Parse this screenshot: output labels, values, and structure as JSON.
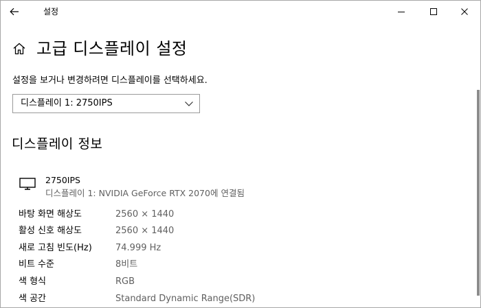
{
  "window": {
    "title": "설정",
    "back_icon": "arrow-left",
    "controls": [
      "minimize",
      "maximize",
      "close"
    ]
  },
  "page": {
    "title": "고급 디스플레이 설정",
    "home_icon": "home",
    "instruction": "설정을 보거나 변경하려면 디스플레이를 선택하세요."
  },
  "display_select": {
    "selected": "디스플레이 1: 2750IPS"
  },
  "display_info": {
    "section_title": "디스플레이 정보",
    "monitor_icon": "monitor",
    "monitor_name": "2750IPS",
    "monitor_connection": "디스플레이 1: NVIDIA GeForce RTX 2070에 연결됨",
    "rows": [
      {
        "label": "바탕 화면 해상도",
        "value": "2560 × 1440"
      },
      {
        "label": "활성 신호 해상도",
        "value": "2560 × 1440"
      },
      {
        "label": "새로 고침 빈도(Hz)",
        "value": "74.999 Hz"
      },
      {
        "label": "비트 수준",
        "value": "8비트"
      },
      {
        "label": "색 형식",
        "value": "RGB"
      },
      {
        "label": "색 공간",
        "value": "Standard Dynamic Range(SDR)"
      }
    ]
  }
}
